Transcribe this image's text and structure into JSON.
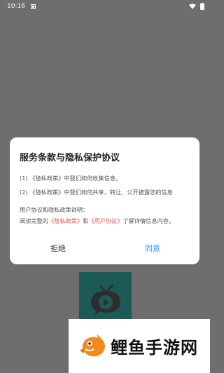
{
  "status_bar": {
    "time": "10:16",
    "icons": [
      "notification-icon",
      "wifi-icon",
      "battery-icon"
    ]
  },
  "dialog": {
    "title": "服务条款与隐私保护协议",
    "item1": {
      "prefix": "(1) 《隐私政策》中我们如何收集信息。"
    },
    "item2": {
      "prefix": "(2) 《隐私政策》中我们如何共享、转让、公开披露您的信息"
    },
    "note_heading": "用户协议和隐私政策说明：",
    "note_line": {
      "part1": "阅读完整的",
      "link1": "《隐私政策》",
      "part2": "和",
      "link2": "《用户协议》",
      "part3": "了解详情信息内容。"
    },
    "buttons": {
      "reject": "拒绝",
      "agree": "同意"
    }
  },
  "colors": {
    "background": "#6e6e6e",
    "dialog": "#ffffff",
    "link_red": "#e3574b",
    "agree_blue": "#2d9bf0",
    "app_icon_bg": "#1b5a55"
  },
  "app_icon": {
    "name": "tv-chat-icon"
  },
  "watermark": {
    "text": "鲤鱼手游网"
  }
}
